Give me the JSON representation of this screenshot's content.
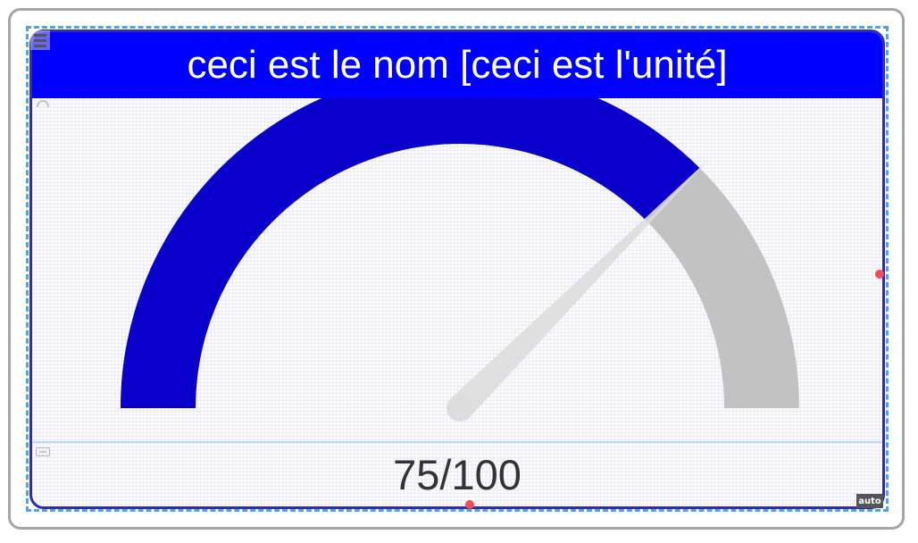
{
  "widget": {
    "title": "ceci est le nom [ceci est l'unité]",
    "value_display": "75/100",
    "auto_badge": "auto"
  },
  "gauge": {
    "value": 75,
    "min": 0,
    "max": 100,
    "fill_color": "#0a00cc",
    "track_color": "#c2c2c2",
    "needle_color": "#dddddd"
  },
  "colors": {
    "title_bg": "#0000ff",
    "border": "#2f2ab8",
    "selection": "#4fa3e8",
    "handle": "#ee4c5a"
  },
  "icons": {
    "menu": "hamburger-icon",
    "gauge": "gauge-icon",
    "badge": "resize-icon"
  }
}
